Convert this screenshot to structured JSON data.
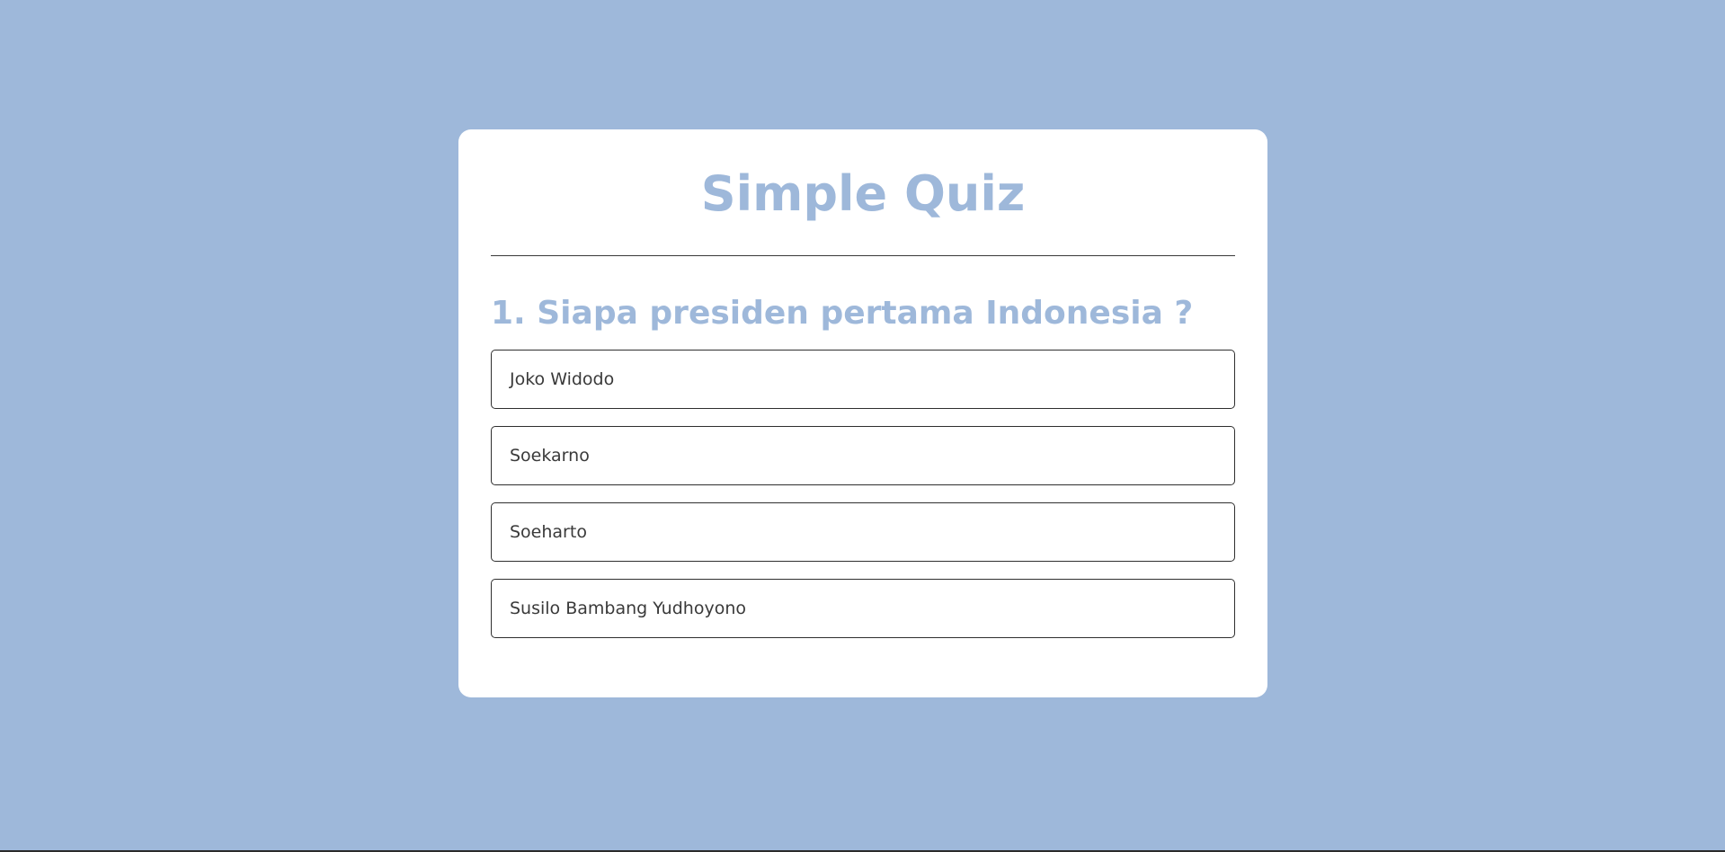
{
  "quiz": {
    "title": "Simple Quiz",
    "question": "1. Siapa presiden pertama Indonesia ?",
    "options": [
      "Joko Widodo",
      "Soekarno",
      "Soeharto",
      "Susilo Bambang Yudhoyono"
    ]
  },
  "colors": {
    "background": "#9eb8da",
    "card": "#ffffff",
    "accent": "#9eb8da",
    "border": "#2f2f2f"
  }
}
